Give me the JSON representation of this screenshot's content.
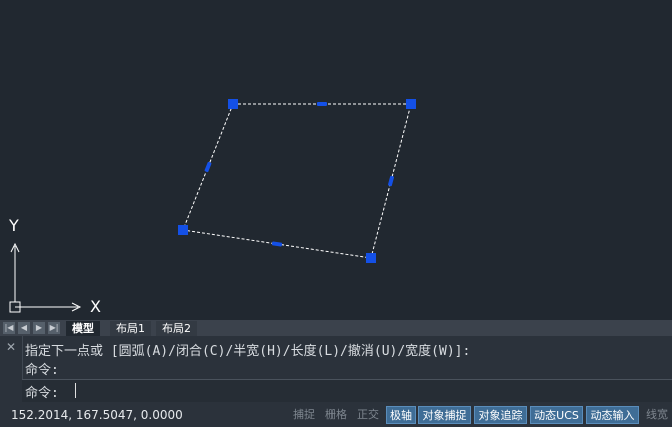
{
  "canvas": {
    "axis_y": "Y",
    "axis_x": "X"
  },
  "tabs": {
    "nav": [
      "|◀",
      "◀",
      "▶",
      "▶|"
    ],
    "items": [
      {
        "label": "模型",
        "active": true
      },
      {
        "label": "布局1",
        "active": false
      },
      {
        "label": "布局2",
        "active": false
      }
    ]
  },
  "command": {
    "history": [
      "指定下一点或 [圆弧(A)/闭合(C)/半宽(H)/长度(L)/撤消(U)/宽度(W)]:",
      "命令:"
    ],
    "prompt": "命令:",
    "close_icon": "close-icon"
  },
  "status": {
    "coords": "152.2014, 167.5047, 0.0000",
    "buttons": [
      {
        "label": "捕捉",
        "on": false
      },
      {
        "label": "栅格",
        "on": false
      },
      {
        "label": "正交",
        "on": false
      },
      {
        "label": "极轴",
        "on": true
      },
      {
        "label": "对象捕捉",
        "on": true
      },
      {
        "label": "对象追踪",
        "on": true
      },
      {
        "label": "动态UCS",
        "on": true
      },
      {
        "label": "动态输入",
        "on": true
      },
      {
        "label": "线宽",
        "on": false
      }
    ]
  },
  "colors": {
    "background": "#212830",
    "grip": "#1450e6",
    "outline": "#ffffff",
    "status_on": "#3f6d96"
  }
}
